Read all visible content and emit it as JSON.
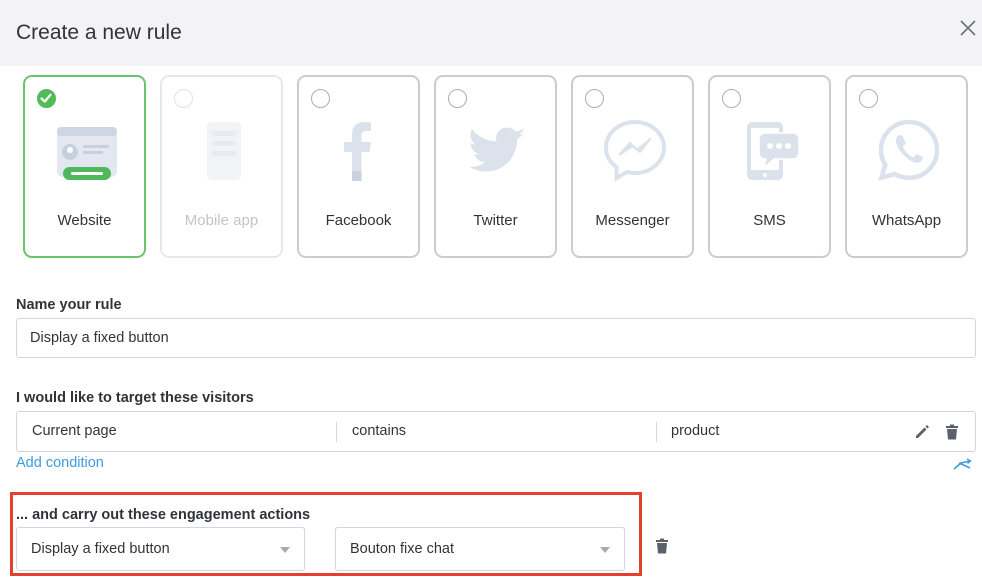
{
  "dialog": {
    "title": "Create a new rule",
    "close_icon": "close-icon"
  },
  "channels": [
    {
      "label": "Website",
      "icon": "website-icon",
      "selected": true,
      "disabled": false
    },
    {
      "label": "Mobile app",
      "icon": "mobile-app-icon",
      "selected": false,
      "disabled": true
    },
    {
      "label": "Facebook",
      "icon": "facebook-icon",
      "selected": false,
      "disabled": false
    },
    {
      "label": "Twitter",
      "icon": "twitter-icon",
      "selected": false,
      "disabled": false
    },
    {
      "label": "Messenger",
      "icon": "messenger-icon",
      "selected": false,
      "disabled": false
    },
    {
      "label": "SMS",
      "icon": "sms-icon",
      "selected": false,
      "disabled": false
    },
    {
      "label": "WhatsApp",
      "icon": "whatsapp-icon",
      "selected": false,
      "disabled": false
    }
  ],
  "rule_name": {
    "label": "Name your rule",
    "value": "Display a fixed button"
  },
  "targeting": {
    "label": "I would like to target these visitors",
    "conditions": [
      {
        "field": "Current page",
        "operator": "contains",
        "value": "product"
      }
    ],
    "add_condition": "Add condition"
  },
  "actions": {
    "label": "... and carry out these engagement actions",
    "action_select": "Display a fixed button",
    "button_select": "Bouton fixe chat"
  },
  "colors": {
    "selected_border": "#6cc46a",
    "check_green": "#52bb58",
    "link_blue": "#3d9be0",
    "highlight_red": "#e3402e",
    "icon_blue": "#dbe2ec"
  }
}
